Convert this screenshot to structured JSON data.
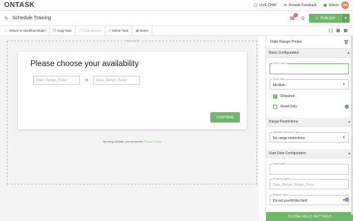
{
  "app": {
    "logo": "ONTASK",
    "live_chat": "LIVE CHAT",
    "feedback": "Provide Feedback",
    "user_name": "Wilson",
    "avatar_initials": "SW"
  },
  "titlebar": {
    "title": "Schedule Training",
    "notification_count": "1",
    "publish_label": "PUBLISH"
  },
  "toolbar": {
    "return": "Return to Workflow Model",
    "copy_task": "Copy Task",
    "copy_branch": "Copy Branch",
    "delete_task": "Delete Task",
    "notes": "Notes",
    "code_icons": "{ }"
  },
  "preview": {
    "label": "PREVIEW",
    "heading": "Please choose your availability",
    "from_placeholder": "Date_Range_Picker",
    "to_label": "to",
    "to_placeholder": "Date_Range_Picker",
    "continue": "CONTINUE",
    "privacy_prefix": "By using OnTask, you accept the ",
    "privacy_link": "Privacy Policy"
  },
  "panel": {
    "title": "Date Range Picker",
    "basic_section": "Basic Configuration",
    "field_label_label": "Field Label",
    "field_label_value": "",
    "field_size_label": "Field Size",
    "field_size_value": "Medium",
    "required_label": "Required",
    "required_checked": true,
    "readonly_label": "Read-Only",
    "readonly_checked": false,
    "restrictions_section": "Range Restrictions",
    "selection_bounds_label": "Selection Bounds Type",
    "selection_bounds_value": "No range restrictions",
    "start_section": "Start Date Configuration",
    "start_label_label": "Start Label",
    "start_label_value": "",
    "property_name_label": "Property Name",
    "property_name_value": "Date_Range_Picker_From",
    "default_value_label": "Default Value",
    "default_value_value": "Do not pre-fill this field",
    "close_settings": "CLOSE FIELD SETTINGS"
  },
  "colors": {
    "accent": "#6fb86a",
    "badge": "#e05a4f",
    "avatar": "#e8825a",
    "help": "#6b8fb8"
  }
}
